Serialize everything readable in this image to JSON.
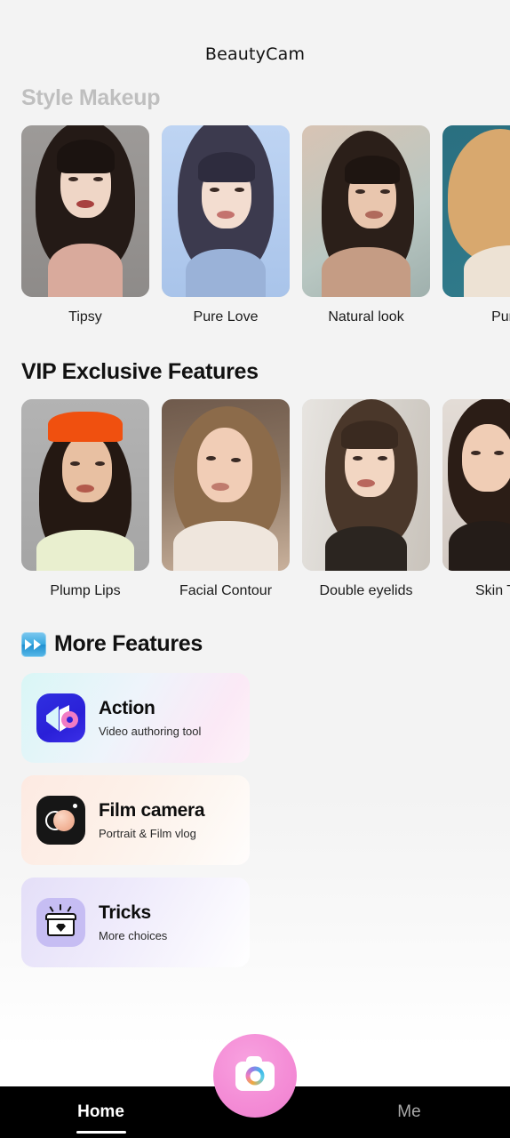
{
  "app": {
    "title": "BeautyCam",
    "background_color": "#f3f3f3"
  },
  "sections": {
    "style_makeup": {
      "heading": "Style Makeup",
      "heading_color": "#bfbfbf",
      "items": [
        {
          "label": "Tipsy"
        },
        {
          "label": "Pure Love"
        },
        {
          "label": "Natural look"
        },
        {
          "label": "Pure"
        }
      ]
    },
    "vip": {
      "heading": "VIP Exclusive Features",
      "heading_color": "#111111",
      "items": [
        {
          "label": "Plump Lips"
        },
        {
          "label": "Facial Contour"
        },
        {
          "label": "Double eyelids"
        },
        {
          "label": "Skin Tone"
        }
      ]
    },
    "more_features": {
      "heading": "More Features",
      "heading_icon": "fast-forward-icon",
      "cards": [
        {
          "title": "Action",
          "subtitle": "Video authoring tool",
          "icon": "action-app-icon",
          "icon_color": "#2a20d8",
          "card_color": "#d9f6f6"
        },
        {
          "title": "Film camera",
          "subtitle": "Portrait & Film vlog",
          "icon": "film-camera-app-icon",
          "icon_color": "#161616",
          "card_color": "#fdeae2"
        },
        {
          "title": "Tricks",
          "subtitle": "More choices",
          "icon": "treasure-box-icon",
          "icon_color": "#c6bdf3",
          "card_color": "#e4dff8"
        }
      ]
    }
  },
  "bottom_nav": {
    "background_color": "#000000",
    "items": [
      {
        "label": "Home",
        "active": true
      },
      {
        "label": "Me",
        "active": false
      }
    ],
    "camera_button": {
      "icon": "camera-icon",
      "color": "#f48dd6"
    }
  }
}
